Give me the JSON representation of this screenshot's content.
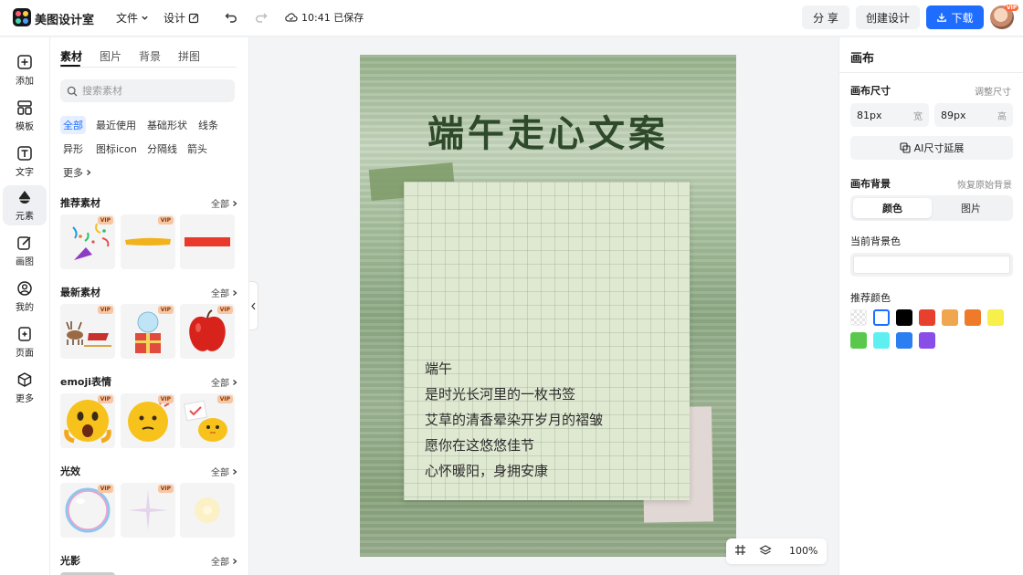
{
  "app": {
    "title": "美图设计室"
  },
  "topbar": {
    "file_menu": "文件",
    "design_menu": "设计",
    "save_status": "10:41 已保存",
    "share_label": "分 享",
    "create_label": "创建设计",
    "download_label": "下载",
    "avatar_badge": "VIP"
  },
  "rail": [
    {
      "label": "添加",
      "icon": "plus-square-icon"
    },
    {
      "label": "模板",
      "icon": "template-icon"
    },
    {
      "label": "文字",
      "icon": "text-icon"
    },
    {
      "label": "元素",
      "icon": "shapes-icon"
    },
    {
      "label": "画图",
      "icon": "pen-icon"
    },
    {
      "label": "我的",
      "icon": "user-icon"
    },
    {
      "label": "页面",
      "icon": "page-add-icon"
    },
    {
      "label": "更多",
      "icon": "cube-icon"
    }
  ],
  "panel": {
    "tabs": [
      "素材",
      "图片",
      "背景",
      "拼图"
    ],
    "search_placeholder": "搜索素材",
    "chips": [
      "全部",
      "最近使用",
      "基础形状",
      "线条",
      "异形",
      "图标icon",
      "分隔线",
      "箭头",
      "更多"
    ],
    "all_label": "全部",
    "vip_label": "VIP",
    "sections": [
      "推荐素材",
      "最新素材",
      "emoji表情",
      "光效",
      "光影"
    ]
  },
  "canvas": {
    "title": "端午走心文案",
    "poem": [
      "端午",
      "是时光长河里的一枚书签",
      "艾草的清香晕染开岁月的褶皱",
      "愿你在这悠悠佳节",
      "心怀暖阳，身拥安康"
    ]
  },
  "zoom": {
    "level": "100%"
  },
  "right_panel": {
    "title": "画布",
    "size_label": "画布尺寸",
    "adjust_label": "调整尺寸",
    "width_value": "81px",
    "width_unit": "宽",
    "height_value": "89px",
    "height_unit": "高",
    "ai_extend_label": "AI尺寸延展",
    "bg_label": "画布背景",
    "restore_label": "恢复原始背景",
    "color_tab": "颜色",
    "image_tab": "图片",
    "current_bg_label": "当前背景色",
    "recommend_label": "推荐颜色",
    "swatches": [
      "transparent",
      "#ffffff",
      "#000000",
      "#e8402f",
      "#f0a54f",
      "#ef7b2a",
      "#f7ef4a",
      "#5ac84c",
      "#5ef0f0",
      "#2b7ff0",
      "#8a4ee8"
    ]
  }
}
